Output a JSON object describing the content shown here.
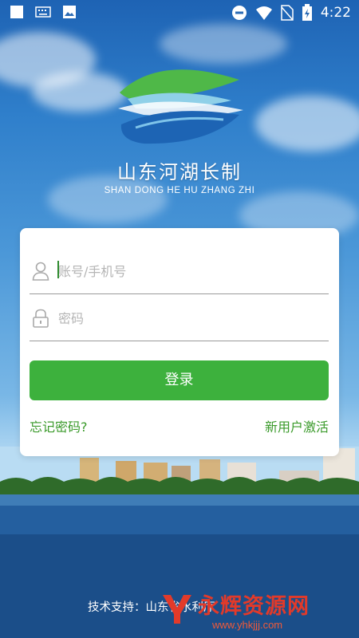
{
  "status_bar": {
    "time": "4:22",
    "icons": [
      "square-notification-icon",
      "keyboard-icon",
      "image-icon",
      "do-not-disturb-icon",
      "wifi-icon",
      "no-sim-icon",
      "battery-charging-icon"
    ]
  },
  "branding": {
    "title": "山东河湖长制",
    "subtitle": "SHAN DONG HE HU ZHANG ZHI"
  },
  "login": {
    "account_placeholder": "账号/手机号",
    "password_placeholder": "密码",
    "login_label": "登录",
    "forgot_label": "忘记密码?",
    "activate_label": "新用户激活"
  },
  "footer": {
    "support_text": "技术支持：山东省水利厅"
  },
  "watermark": {
    "text": "永辉资源网",
    "url": "www.yhkjjj.com"
  },
  "colors": {
    "accent_green": "#3db13d",
    "link_green": "#3a9a2a"
  }
}
